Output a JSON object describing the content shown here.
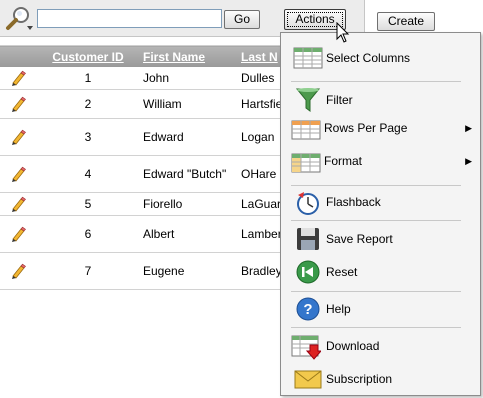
{
  "toolbar": {
    "search_value": "",
    "go_label": "Go",
    "actions_label": "Actions",
    "create_label": "Create"
  },
  "table": {
    "headers": [
      "Customer ID",
      "First Name",
      "Last N"
    ],
    "rows": [
      {
        "id": "1",
        "first": "John",
        "last": "Dulles"
      },
      {
        "id": "2",
        "first": "William",
        "last": "Hartsfie"
      },
      {
        "id": "3",
        "first": "Edward",
        "last": "Logan"
      },
      {
        "id": "4",
        "first": "Edward \"Butch\"",
        "last": "OHare"
      },
      {
        "id": "5",
        "first": "Fiorello",
        "last": "LaGuar"
      },
      {
        "id": "6",
        "first": "Albert",
        "last": "Lamber"
      },
      {
        "id": "7",
        "first": "Eugene",
        "last": "Bradley"
      }
    ]
  },
  "menu": {
    "items": [
      {
        "label": "Select Columns",
        "icon": "select-columns-icon"
      },
      {
        "label": "Filter",
        "icon": "filter-icon"
      },
      {
        "label": "Rows Per Page",
        "icon": "rows-per-page-icon",
        "submenu": true
      },
      {
        "label": "Format",
        "icon": "format-icon",
        "submenu": true
      },
      {
        "label": "Flashback",
        "icon": "flashback-icon"
      },
      {
        "label": "Save Report",
        "icon": "save-icon"
      },
      {
        "label": "Reset",
        "icon": "reset-icon"
      },
      {
        "label": "Help",
        "icon": "help-icon"
      },
      {
        "label": "Download",
        "icon": "download-icon"
      },
      {
        "label": "Subscription",
        "icon": "subscription-icon"
      }
    ]
  },
  "colors": {
    "header_bg": "#a8a8a8",
    "menu_bg": "#f4f4f4",
    "filter_green": "#3a8a3a",
    "help_blue": "#2f6fc8",
    "subscription_yellow": "#f2c94c"
  }
}
